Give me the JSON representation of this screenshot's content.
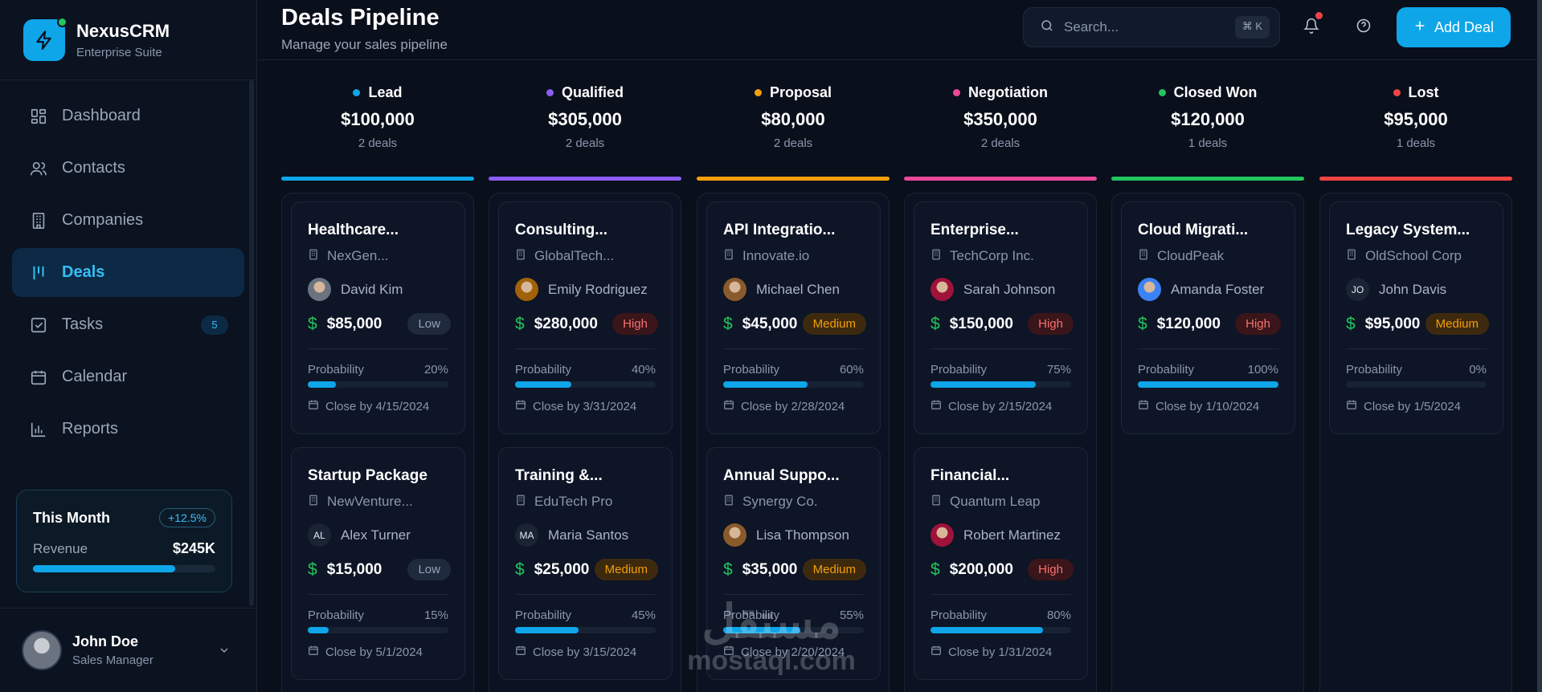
{
  "brand": {
    "name": "NexusCRM",
    "subtitle": "Enterprise Suite",
    "accent": "#0ea5e9"
  },
  "nav": [
    {
      "label": "Dashboard",
      "icon": "dashboard-icon"
    },
    {
      "label": "Contacts",
      "icon": "users-icon"
    },
    {
      "label": "Companies",
      "icon": "building-icon"
    },
    {
      "label": "Deals",
      "icon": "pipeline-icon",
      "active": true
    },
    {
      "label": "Tasks",
      "icon": "checkbox-icon",
      "badge": "5"
    },
    {
      "label": "Calendar",
      "icon": "calendar-icon"
    },
    {
      "label": "Reports",
      "icon": "bar-chart-icon"
    }
  ],
  "month": {
    "title": "This Month",
    "change": "+12.5%",
    "label": "Revenue",
    "value": "$245K"
  },
  "user": {
    "name": "John Doe",
    "role": "Sales Manager"
  },
  "header": {
    "title": "Deals Pipeline",
    "subtitle": "Manage your sales pipeline",
    "search_placeholder": "Search...",
    "shortcut": "⌘ K",
    "add_label": "Add Deal"
  },
  "columns": [
    {
      "name": "Lead",
      "color": "#0ea5e9",
      "total": "$100,000",
      "count": "2 deals",
      "deals": [
        {
          "title": "Healthcare...",
          "company": "NexGen...",
          "person": "David Kim",
          "avatar": "",
          "amount": "$85,000",
          "priority": "Low",
          "prob_label": "Probability",
          "prob": "20%",
          "prob_value": 20,
          "close": "Close by 4/15/2024"
        },
        {
          "title": "Startup Package",
          "company": "NewVenture...",
          "person": "Alex Turner",
          "avatar": "AL",
          "amount": "$15,000",
          "priority": "Low",
          "prob_label": "Probability",
          "prob": "15%",
          "prob_value": 15,
          "close": "Close by 5/1/2024"
        }
      ]
    },
    {
      "name": "Qualified",
      "color": "#8b5cf6",
      "total": "$305,000",
      "count": "2 deals",
      "deals": [
        {
          "title": "Consulting...",
          "company": "GlobalTech...",
          "person": "Emily Rodriguez",
          "avatar": "",
          "amount": "$280,000",
          "priority": "High",
          "prob_label": "Probability",
          "prob": "40%",
          "prob_value": 40,
          "close": "Close by 3/31/2024"
        },
        {
          "title": "Training &...",
          "company": "EduTech Pro",
          "person": "Maria Santos",
          "avatar": "MA",
          "amount": "$25,000",
          "priority": "Medium",
          "prob_label": "Probability",
          "prob": "45%",
          "prob_value": 45,
          "close": "Close by 3/15/2024"
        }
      ]
    },
    {
      "name": "Proposal",
      "color": "#f59e0b",
      "total": "$80,000",
      "count": "2 deals",
      "deals": [
        {
          "title": "API Integratio...",
          "company": "Innovate.io",
          "person": "Michael Chen",
          "avatar": "",
          "amount": "$45,000",
          "priority": "Medium",
          "prob_label": "Probability",
          "prob": "60%",
          "prob_value": 60,
          "close": "Close by 2/28/2024"
        },
        {
          "title": "Annual Suppo...",
          "company": "Synergy Co.",
          "person": "Lisa Thompson",
          "avatar": "",
          "amount": "$35,000",
          "priority": "Medium",
          "prob_label": "Probability",
          "prob": "55%",
          "prob_value": 55,
          "close": "Close by 2/20/2024"
        }
      ]
    },
    {
      "name": "Negotiation",
      "color": "#ec4899",
      "total": "$350,000",
      "count": "2 deals",
      "deals": [
        {
          "title": "Enterprise...",
          "company": "TechCorp Inc.",
          "person": "Sarah Johnson",
          "avatar": "",
          "amount": "$150,000",
          "priority": "High",
          "prob_label": "Probability",
          "prob": "75%",
          "prob_value": 75,
          "close": "Close by 2/15/2024"
        },
        {
          "title": "Financial...",
          "company": "Quantum Leap",
          "person": "Robert Martinez",
          "avatar": "",
          "amount": "$200,000",
          "priority": "High",
          "prob_label": "Probability",
          "prob": "80%",
          "prob_value": 80,
          "close": "Close by 1/31/2024"
        }
      ]
    },
    {
      "name": "Closed Won",
      "color": "#22c55e",
      "total": "$120,000",
      "count": "1 deals",
      "deals": [
        {
          "title": "Cloud Migrati...",
          "company": "CloudPeak",
          "person": "Amanda Foster",
          "avatar": "",
          "amount": "$120,000",
          "priority": "High",
          "prob_label": "Probability",
          "prob": "100%",
          "prob_value": 100,
          "close": "Close by 1/10/2024"
        }
      ]
    },
    {
      "name": "Lost",
      "color": "#ef4444",
      "total": "$95,000",
      "count": "1 deals",
      "deals": [
        {
          "title": "Legacy System...",
          "company": "OldSchool Corp",
          "person": "John Davis",
          "avatar": "JO",
          "amount": "$95,000",
          "priority": "Medium",
          "prob_label": "Probability",
          "prob": "0%",
          "prob_value": 0,
          "close": "Close by 1/5/2024"
        }
      ]
    }
  ],
  "watermark": {
    "arabic": "مستقل",
    "latin": "mostaql.com"
  }
}
